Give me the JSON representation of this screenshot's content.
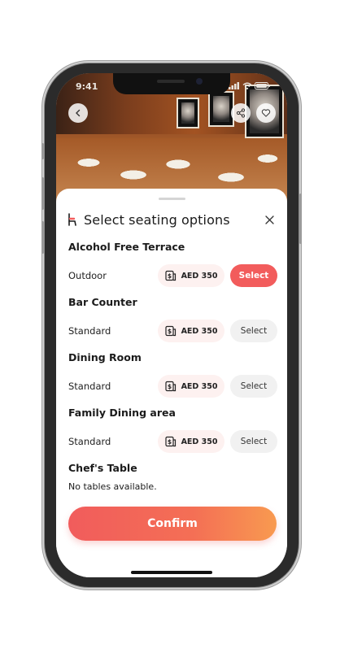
{
  "status_bar": {
    "time": "9:41"
  },
  "header": {
    "back_icon": "chevron-left-icon",
    "share_icon": "share-icon",
    "favorite_icon": "heart-icon"
  },
  "sheet": {
    "title": "Select seating options",
    "title_icon": "chair-icon",
    "close_icon": "close-icon",
    "options": [
      {
        "name": "Alcohol Free Terrace",
        "type": "Outdoor",
        "price": "AED 350",
        "select_label": "Select",
        "selected": true
      },
      {
        "name": "Bar Counter",
        "type": "Standard",
        "price": "AED 350",
        "select_label": "Select",
        "selected": false
      },
      {
        "name": "Dining Room",
        "type": "Standard",
        "price": "AED 350",
        "select_label": "Select",
        "selected": false
      },
      {
        "name": "Family Dining area",
        "type": "Standard",
        "price": "AED 350",
        "select_label": "Select",
        "selected": false
      }
    ],
    "unavailable": {
      "name": "Chef's Table",
      "message": "No tables available."
    },
    "confirm_label": "Confirm"
  },
  "colors": {
    "accent": "#f25c5c",
    "accent_end": "#f89a50",
    "price_pill_bg": "#fdf1f0"
  }
}
